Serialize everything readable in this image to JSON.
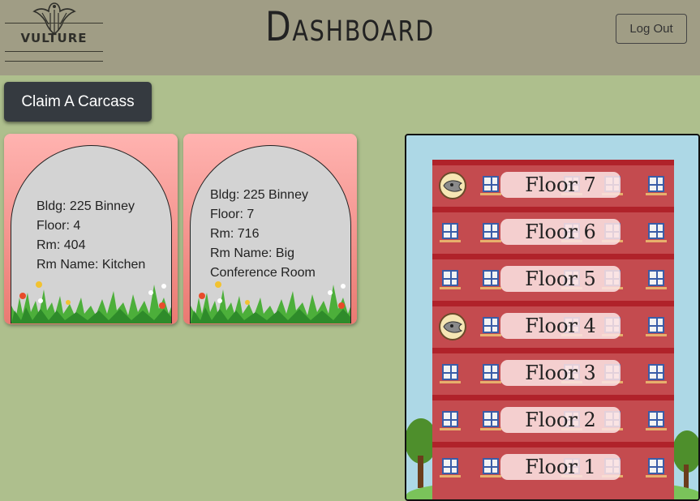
{
  "header": {
    "logo_text": "VULTURE",
    "title": "Dashboard",
    "logout_label": "Log Out"
  },
  "actions": {
    "claim_label": "Claim A Carcass"
  },
  "cards": [
    {
      "lines": [
        "Bldg: 225 Binney",
        "Floor: 4",
        "Rm: 404",
        "Rm Name: Kitchen"
      ]
    },
    {
      "lines": [
        "Bldg: 225 Binney",
        "Floor: 7",
        "Rm: 716",
        "Rm Name: Big",
        "Conference Room"
      ]
    }
  ],
  "building": {
    "floors": [
      {
        "label": "Floor 7",
        "vulture": true
      },
      {
        "label": "Floor 6",
        "vulture": false
      },
      {
        "label": "Floor 5",
        "vulture": false
      },
      {
        "label": "Floor 4",
        "vulture": true
      },
      {
        "label": "Floor 3",
        "vulture": false
      },
      {
        "label": "Floor 2",
        "vulture": false
      },
      {
        "label": "Floor 1",
        "vulture": false
      }
    ],
    "colors": {
      "sky": "#add8e6",
      "wall": "#c44b4f",
      "band": "#b0222a",
      "grass": "#7ac35a"
    }
  },
  "icons": [
    "vulture-logo-icon",
    "vulture-skull-icon",
    "grass-flowers-icon",
    "tree-icon",
    "window-icon"
  ]
}
